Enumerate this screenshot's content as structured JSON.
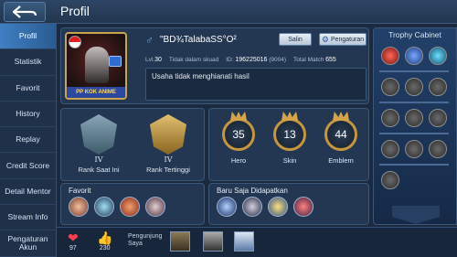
{
  "header": {
    "title": "Profil"
  },
  "sidebar": {
    "items": [
      {
        "label": "Profil",
        "active": true
      },
      {
        "label": "Statistik"
      },
      {
        "label": "Favorit"
      },
      {
        "label": "History"
      },
      {
        "label": "Replay"
      },
      {
        "label": "Credit Score"
      },
      {
        "label": "Detail Mentor"
      },
      {
        "label": "Stream Info"
      },
      {
        "label": "Pengaturan Akun"
      }
    ]
  },
  "profile": {
    "gender_symbol": "♂",
    "name": "\"BD¾TalabaSS°O²",
    "salin_label": "Salin",
    "settings_label": "Pengaturan",
    "level_label": "Lvl.",
    "level": "30",
    "squad": "Tidak dalam skuad",
    "id_label": "ID:",
    "id_value": "196225016",
    "server": "(9004)",
    "total_match_label": "Total Match",
    "total_match": "655",
    "motto": "Usaha tidak menghianati hasil",
    "avatar_banner": "PP KOK ANIME"
  },
  "ranks": {
    "current": {
      "tier": "IV",
      "label": "Rank Saat Ini"
    },
    "highest": {
      "tier": "IV",
      "label": "Rank Tertinggi"
    }
  },
  "stats": {
    "hero": {
      "value": "35",
      "label": "Hero"
    },
    "skin": {
      "value": "13",
      "label": "Skin"
    },
    "emblem": {
      "value": "44",
      "label": "Emblem"
    }
  },
  "favorit": {
    "title": "Favorit"
  },
  "recent": {
    "title": "Baru Saja Didapatkan"
  },
  "trophy": {
    "title": "Trophy Cabinet"
  },
  "bottom": {
    "likes_icon": "heart-icon",
    "likes": "97",
    "thumbs_icon": "thumbs-up-icon",
    "thumbs": "230",
    "visitors_label": "Pengunjung Saya"
  },
  "colors": {
    "accent": "#3f7fc2",
    "gold": "#c5963d",
    "background": "#1b2a3f"
  }
}
